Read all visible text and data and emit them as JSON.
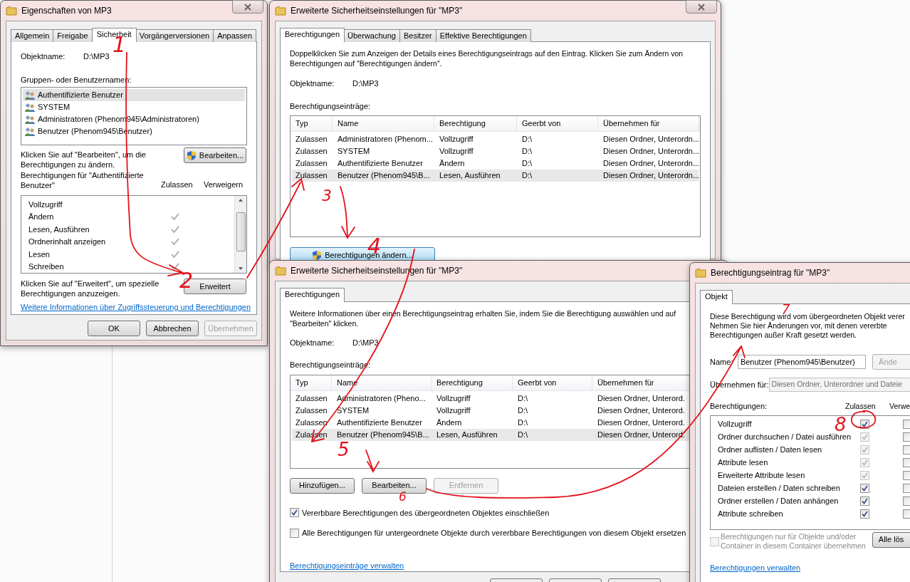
{
  "properties_dialog": {
    "title": "Eigenschaften von MP3",
    "tabs": [
      {
        "label": "Allgemein",
        "selected": false
      },
      {
        "label": "Freigabe",
        "selected": false
      },
      {
        "label": "Sicherheit",
        "selected": true
      },
      {
        "label": "Vorgängerversionen",
        "selected": false
      },
      {
        "label": "Anpassen",
        "selected": false
      }
    ],
    "object_label": "Objektname:",
    "object_value": "D:\\MP3",
    "groups_label": "Gruppen- oder Benutzernamen:",
    "groups": [
      {
        "name": "Authentifizierte Benutzer",
        "selected": true
      },
      {
        "name": "SYSTEM",
        "selected": false
      },
      {
        "name": "Administratoren (Phenom945\\Administratoren)",
        "selected": false
      },
      {
        "name": "Benutzer (Phenom945\\Benutzer)",
        "selected": false
      }
    ],
    "edit_hint": "Klicken Sie auf \"Bearbeiten\", um die\nBerechtigungen zu ändern.",
    "edit_button": "Bearbeiten...",
    "permissions_label": "Berechtigungen für \"Authentifizierte\nBenutzer\"",
    "allow_heading": "Zulassen",
    "deny_heading": "Verweigern",
    "permissions": [
      {
        "name": "Vollzugriff",
        "allow": false
      },
      {
        "name": "Ändern",
        "allow": true
      },
      {
        "name": "Lesen, Ausführen",
        "allow": true
      },
      {
        "name": "Ordnerinhalt anzeigen",
        "allow": true
      },
      {
        "name": "Lesen",
        "allow": true
      },
      {
        "name": "Schreiben",
        "allow": true
      }
    ],
    "advanced_hint": "Klicken Sie auf \"Erweitert\", um spezielle\nBerechtigungen anzuzeigen.",
    "advanced_button": "Erweitert",
    "link": "Weitere Informationen über Zugriffssteuerung und Berechtigungen",
    "buttons": [
      {
        "label": "OK",
        "disabled": false
      },
      {
        "label": "Abbrechen",
        "disabled": false
      },
      {
        "label": "Übernehmen",
        "disabled": true
      }
    ]
  },
  "advanced_dialog": {
    "title": "Erweiterte Sicherheitseinstellungen für \"MP3\"",
    "tabs": [
      {
        "label": "Berechtigungen",
        "selected": true
      },
      {
        "label": "Überwachung",
        "selected": false
      },
      {
        "label": "Besitzer",
        "selected": false
      },
      {
        "label": "Effektive Berechtigungen",
        "selected": false
      }
    ],
    "intro": "Doppelklicken Sie zum Anzeigen der Details eines Berechtigungseintrags auf den Eintrag. Klicken Sie zum Ändern von\nBerechtigungen auf \"Berechtigungen ändern\".",
    "object_label": "Objektname:",
    "object_value": "D:\\MP3",
    "entries_label": "Berechtigungseinträge:",
    "columns": [
      "Typ",
      "Name",
      "Berechtigung",
      "Geerbt von",
      "Übernehmen für"
    ],
    "rows": [
      {
        "cells": [
          "Zulassen",
          "Administratoren (Phenom...",
          "Vollzugriff",
          "D:\\",
          "Diesen Ordner, Unterordn..."
        ],
        "selected": false
      },
      {
        "cells": [
          "Zulassen",
          "SYSTEM",
          "Vollzugriff",
          "D:\\",
          "Diesen Ordner, Unterordn..."
        ],
        "selected": false
      },
      {
        "cells": [
          "Zulassen",
          "Authentifizierte Benutzer",
          "Ändern",
          "D:\\",
          "Diesen Ordner, Unterordn..."
        ],
        "selected": false
      },
      {
        "cells": [
          "Zulassen",
          "Benutzer (Phenom945\\B...",
          "Lesen, Ausführen",
          "D:\\",
          "Diesen Ordner, Unterordn..."
        ],
        "selected": true
      }
    ],
    "change_button": "Berechtigungen ändern..."
  },
  "advanced_edit_dialog": {
    "title": "Erweiterte Sicherheitseinstellungen für \"MP3\"",
    "tabs": [
      {
        "label": "Berechtigungen",
        "selected": true
      }
    ],
    "intro": "Weitere Informationen über einen Berechtigungseintrag erhalten Sie, indem Sie die Berechtigung auswählen und auf\n\"Bearbeiten\" klicken.",
    "object_label": "Objektname:",
    "object_value": "D:\\MP3",
    "entries_label": "Berechtigungseinträge:",
    "columns": [
      "Typ",
      "Name",
      "Berechtigung",
      "Geerbt von",
      "Übernehmen für"
    ],
    "rows": [
      {
        "cells": [
          "Zulassen",
          "Administratoren (Pheno...",
          "Vollzugriff",
          "D:\\",
          "Diesen Ordner, Unterord."
        ],
        "selected": false
      },
      {
        "cells": [
          "Zulassen",
          "SYSTEM",
          "Vollzugriff",
          "D:\\",
          "Diesen Ordner, Unterord."
        ],
        "selected": false
      },
      {
        "cells": [
          "Zulassen",
          "Authentifizierte Benutzer",
          "Ändern",
          "D:\\",
          "Diesen Ordner, Unterord."
        ],
        "selected": false
      },
      {
        "cells": [
          "Zulassen",
          "Benutzer (Phenom945\\B...",
          "Lesen, Ausführen",
          "D:\\",
          "Diesen Ordner, Unterord."
        ],
        "selected": true
      }
    ],
    "buttons": [
      {
        "label": "Hinzufügen...",
        "disabled": false
      },
      {
        "label": "Bearbeiten...",
        "disabled": false
      },
      {
        "label": "Entfernen",
        "disabled": true
      }
    ],
    "options": [
      {
        "label": "Vererbbare Berechtigungen des übergeordneten Objektes einschließen",
        "checked": true
      },
      {
        "label": "Alle Berechtigungen für untergeordnete Objekte durch vererbbare Berechtigungen von diesem Objekt ersetzen",
        "checked": false
      }
    ],
    "link": "Berechtigungseinträge verwalten"
  },
  "entry_dialog": {
    "title": "Berechtigungseintrag für \"MP3\"",
    "tabs": [
      {
        "label": "Objekt",
        "selected": true
      }
    ],
    "intro": "Diese Berechtigung wird vom übergeordneten Objekt verer\nNehmen Sie hier Änderungen vor, mit denen vererbte\nBerechtigungen außer Kraft gesetzt werden.",
    "name_label": "Name:",
    "name_value": "Benutzer (Phenom945\\Benutzer)",
    "change_button": "Ände",
    "apply_label": "Übernehmen für:",
    "apply_value": "Diesen Ordner, Unterordner und Dateie",
    "permissions_label": "Berechtigungen:",
    "allow_heading": "Zulassen",
    "deny_heading": "Verwe",
    "permissions": [
      {
        "name": "Vollzugriff",
        "allow": true,
        "allow_disabled": false,
        "deny": false
      },
      {
        "name": "Ordner durchsuchen / Datei ausführen",
        "allow": true,
        "allow_disabled": true,
        "deny": false
      },
      {
        "name": "Ordner auflisten / Daten lesen",
        "allow": true,
        "allow_disabled": true,
        "deny": false
      },
      {
        "name": "Attribute lesen",
        "allow": true,
        "allow_disabled": true,
        "deny": false
      },
      {
        "name": "Erweiterte Attribute lesen",
        "allow": true,
        "allow_disabled": true,
        "deny": false
      },
      {
        "name": "Dateien erstellen / Daten schreiben",
        "allow": true,
        "allow_disabled": false,
        "deny": false
      },
      {
        "name": "Ordner erstellen / Daten anhängen",
        "allow": true,
        "allow_disabled": false,
        "deny": false
      },
      {
        "name": "Attribute schreiben",
        "allow": true,
        "allow_disabled": false,
        "deny": false
      }
    ],
    "scope_option": {
      "label": "Berechtigungen nur für Objekte und/oder\nContainer in diesem Container übernehmen",
      "checked": false,
      "disabled": true
    },
    "clear_button": "Alle lös",
    "link": "Berechtigungen verwalten"
  },
  "annotations": [
    {
      "label": "1"
    },
    {
      "label": "2"
    },
    {
      "label": "3"
    },
    {
      "label": "4"
    },
    {
      "label": "5"
    },
    {
      "label": "6"
    },
    {
      "label": "7"
    },
    {
      "label": "8"
    }
  ]
}
